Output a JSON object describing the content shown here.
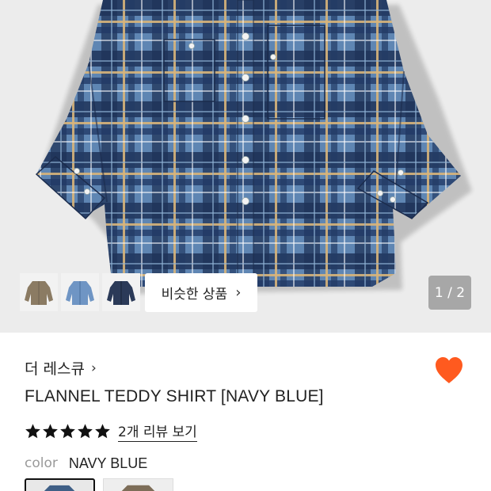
{
  "product": {
    "brand": "더 레스큐",
    "title": "FLANNEL TEDDY SHIRT [NAVY BLUE]",
    "rating_stars": 5,
    "review_link": "2개 리뷰 보기",
    "color_label": "color",
    "color_value": "NAVY BLUE"
  },
  "gallery": {
    "similar_button": "비슷한 상품",
    "pager": "1 / 2",
    "thumbnails": [
      "khaki-shirt",
      "light-blue-shirt",
      "navy-shirt"
    ]
  },
  "icons": {
    "wishlist": "heart-icon",
    "brand_arrow": "chevron-right-icon",
    "similar_arrow": "chevron-right-icon",
    "star": "star-icon"
  },
  "colors": {
    "heart": "#ff5a1f",
    "pager_bg": "#a7a7a7",
    "hero_bg": "#ececec"
  }
}
